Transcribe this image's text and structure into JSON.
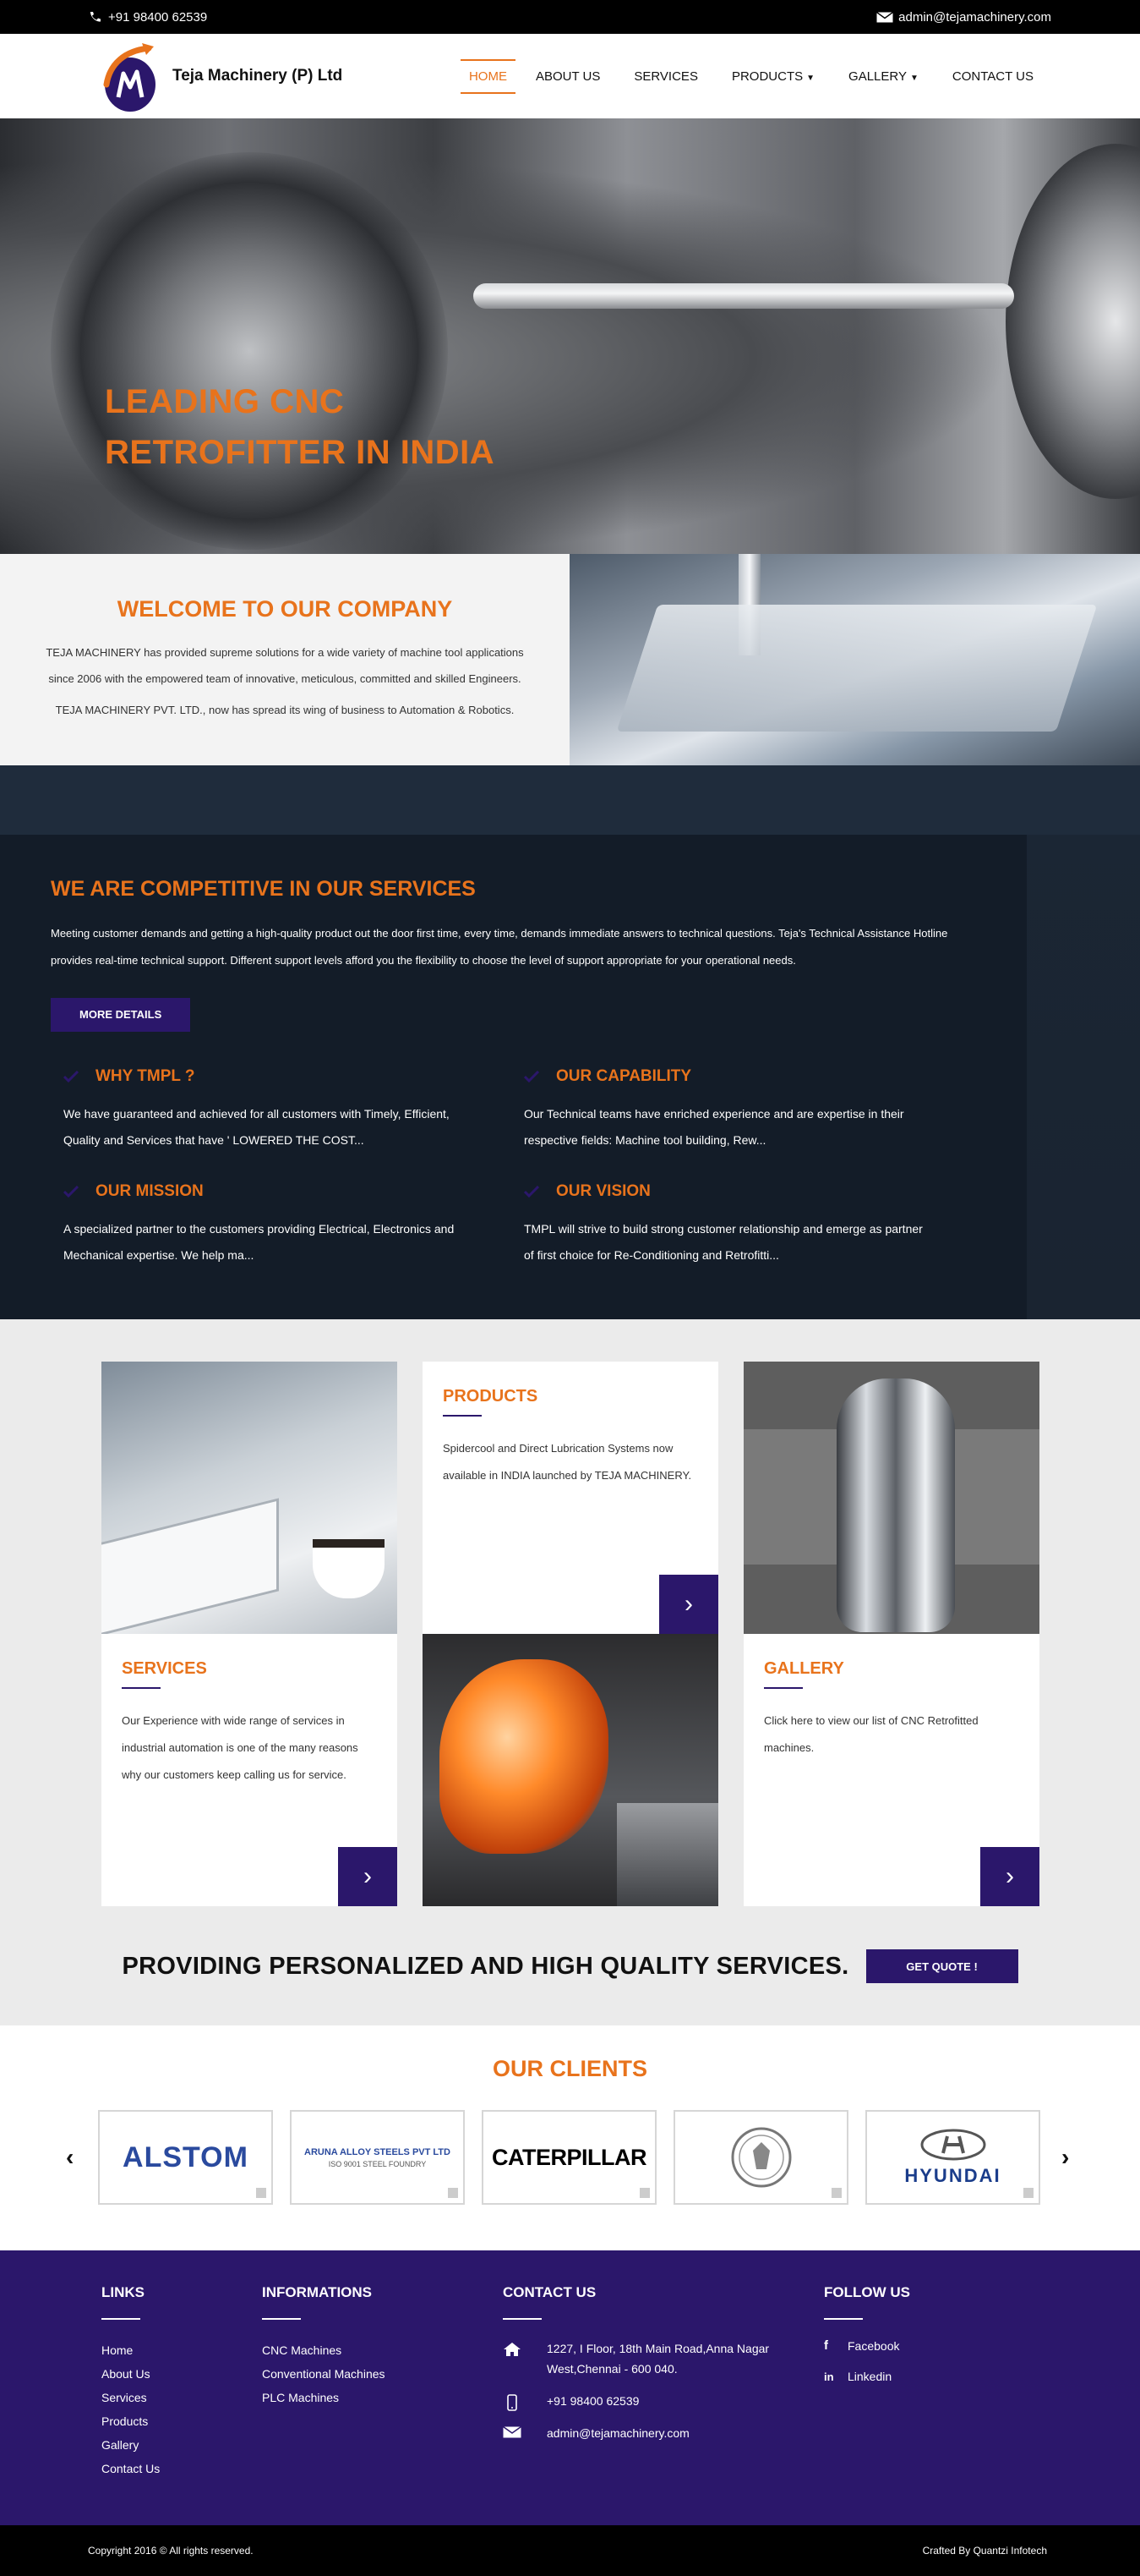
{
  "topbar": {
    "phone": "+91 98400 62539",
    "email": "admin@tejamachinery.com"
  },
  "header": {
    "brand": "Teja Machinery (P) Ltd",
    "nav": [
      {
        "label": "HOME"
      },
      {
        "label": "ABOUT US"
      },
      {
        "label": "SERVICES"
      },
      {
        "label": "PRODUCTS"
      },
      {
        "label": "GALLERY"
      },
      {
        "label": "CONTACT US"
      }
    ]
  },
  "hero": {
    "line1": "LEADING CNC",
    "line2": "RETROFITTER IN INDIA"
  },
  "welcome": {
    "title": "WELCOME TO OUR COMPANY",
    "p1": "TEJA MACHINERY has provided supreme solutions for a wide variety of machine tool applications since 2006 with the empowered team of innovative, meticulous, committed and skilled Engineers.",
    "p2": "TEJA MACHINERY PVT. LTD., now has spread its wing of business to Automation & Robotics."
  },
  "services": {
    "title": "WE ARE COMPETITIVE IN OUR SERVICES",
    "lead": "Meeting customer demands and getting a high-quality product out the door first time, every time, demands immediate answers to technical questions. Teja's Technical Assistance Hotline provides real-time technical support. Different support levels afford you the flexibility to choose the level of support appropriate for your operational needs.",
    "button": "MORE DETAILS",
    "features": [
      {
        "title": "WHY TMPL ?",
        "text": "We have guaranteed and achieved for all customers with Timely, Efficient, Quality and Services that have ' LOWERED THE COST..."
      },
      {
        "title": "OUR CAPABILITY",
        "text": "Our Technical teams have enriched experience and are expertise in their respective fields: Machine tool building, Rew..."
      },
      {
        "title": "OUR MISSION",
        "text": "A specialized partner to the customers providing Electrical, Electronics and Mechanical expertise. We help ma..."
      },
      {
        "title": "OUR VISION",
        "text": "TMPL will strive to build strong customer relationship and emerge as partner of first choice for Re-Conditioning and Retrofitti..."
      }
    ]
  },
  "cards": {
    "products": {
      "title": "PRODUCTS",
      "text": "Spidercool and Direct Lubrication Systems now available in INDIA launched by TEJA MACHINERY."
    },
    "services": {
      "title": "SERVICES",
      "text": "Our Experience with wide range of services in industrial automation is one of the many reasons why our customers keep calling us for service."
    },
    "gallery": {
      "title": "GALLERY",
      "text": "Click here to view our list of CNC Retrofitted machines."
    },
    "arrow": "›"
  },
  "cta": {
    "text": "PROVIDING PERSONALIZED AND HIGH QUALITY SERVICES.",
    "button": "GET QUOTE !"
  },
  "clients": {
    "title": "OUR CLIENTS",
    "prev": "‹",
    "next": "›",
    "logos": {
      "alstom": "ALSTOM",
      "aruna": "ARUNA ALLOY STEELS PVT LTD",
      "aruna_sub": "ISO 9001 STEEL FOUNDRY",
      "caterpillar": "CATERPILLAR",
      "hyundai": "HYUNDAI"
    }
  },
  "footer": {
    "links": {
      "title": "LINKS",
      "items": [
        "Home",
        "About Us",
        "Services",
        "Products",
        "Gallery",
        "Contact Us"
      ]
    },
    "info": {
      "title": "INFORMATIONS",
      "items": [
        "CNC Machines",
        "Conventional Machines",
        "PLC Machines"
      ]
    },
    "contact": {
      "title": "CONTACT US",
      "address": "1227, I Floor, 18th Main Road,Anna Nagar West,Chennai - 600 040.",
      "phone": "+91 98400 62539",
      "email": "admin@tejamachinery.com"
    },
    "follow": {
      "title": "FOLLOW US",
      "facebook": "Facebook",
      "linkedin": "Linkedin"
    },
    "copyright": "Copyright 2016 © All rights reserved.",
    "credit": "Crafted By Quantzi Infotech"
  },
  "colors": {
    "accent": "#e8731c",
    "brand_purple": "#2b176b"
  }
}
